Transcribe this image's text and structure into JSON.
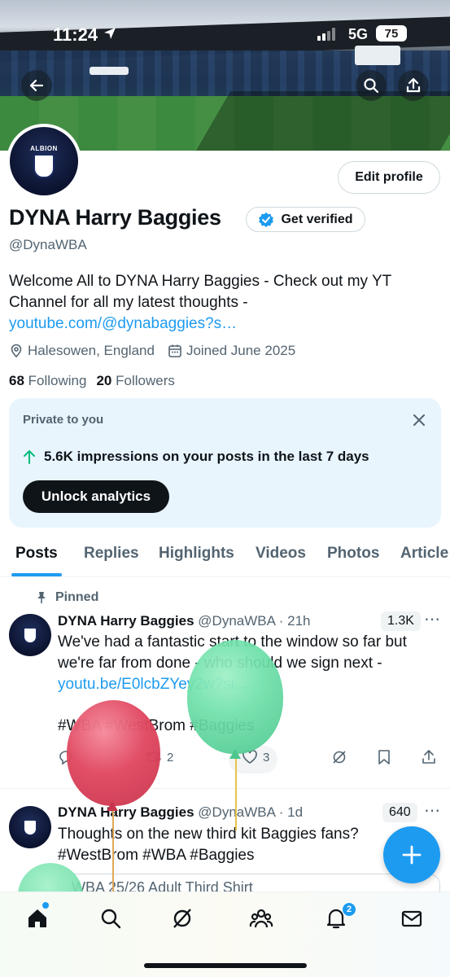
{
  "status_bar": {
    "time": "11:24",
    "network": "5G",
    "battery": "75"
  },
  "profile": {
    "display_name": "DYNA Harry Baggies",
    "handle": "@DynaWBA",
    "avatar_text": "ALBION",
    "edit_profile_label": "Edit profile",
    "get_verified_label": "Get verified",
    "bio_text": "Welcome All to DYNA Harry Baggies - Check out my YT Channel for all my latest thoughts - ",
    "bio_link": "youtube.com/@dynabaggies?s…",
    "location": "Halesowen, England",
    "joined": "Joined June 2025",
    "following_count": "68",
    "following_label": "Following",
    "followers_count": "20",
    "followers_label": "Followers"
  },
  "private_card": {
    "label": "Private to you",
    "impressions_text": "5.6K impressions on your posts in the last 7 days",
    "unlock_label": "Unlock analytics"
  },
  "tabs": [
    {
      "label": "Posts"
    },
    {
      "label": "Replies"
    },
    {
      "label": "Highlights"
    },
    {
      "label": "Videos"
    },
    {
      "label": "Photos"
    },
    {
      "label": "Article"
    }
  ],
  "posts": [
    {
      "pinned_label": "Pinned",
      "name": "DYNA Harry Baggies",
      "handle_time": "@DynaWBA · 21h",
      "views": "1.3K",
      "text": "We've had a fantastic start to the window so far but we're far from done - who should we sign next - ",
      "link": "youtu.be/E0lcbZYey2w?si…",
      "hashtags": "#WBA #WestBrom #Baggies",
      "retweets": "2",
      "likes": "3"
    },
    {
      "name": "DYNA Harry Baggies",
      "handle_time": "@DynaWBA · 1d",
      "views": "640",
      "text": "Thoughts on the new third kit Baggies fans?",
      "hashtags": "#WestBrom #WBA #Baggies",
      "card_title": "WBA 25/26 Adult Third Shirt"
    }
  ],
  "bottom_nav": {
    "notification_count": "2"
  },
  "colors": {
    "accent": "#1d9bf0",
    "text": "#0f1419",
    "muted": "#536471",
    "balloon_red": "#e0475f",
    "balloon_green": "#6fe0aa"
  }
}
